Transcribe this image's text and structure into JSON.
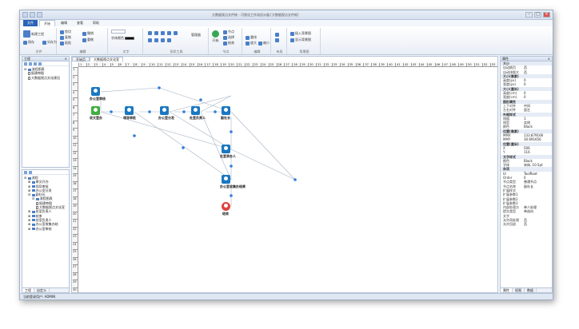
{
  "window": {
    "title": "大数据视点文件帐 - 可视化工作流设计器 [大数据视点文件帐]"
  },
  "tabs": [
    {
      "label": "文件"
    },
    {
      "label": "开始"
    },
    {
      "label": "编辑"
    },
    {
      "label": "查看"
    },
    {
      "label": "帮助"
    }
  ],
  "ribbon": {
    "file_group": {
      "label": "文件",
      "new": "新建工程",
      "open": "打开",
      "save": "保存",
      "save_as": "另存为"
    },
    "edit_group": {
      "label": "编辑",
      "cut": "剪切",
      "copy": "复制",
      "paste": "粘贴",
      "undo": "撤销",
      "redo": "重做"
    },
    "font_group": {
      "label": "文字",
      "font": "宋体",
      "size": "字体颜色"
    },
    "shape_group": {
      "label": "形状工具",
      "sub": "管理器"
    },
    "node_group": {
      "label": "节点",
      "start": "开始",
      "node": "节点",
      "select": "选择",
      "end": "结束"
    },
    "layout_group": {
      "label": "编辑",
      "arrange": "重排",
      "zoom_out": "缩小",
      "zoom_in": "放大"
    },
    "layout2": {
      "label": "布局"
    },
    "bg_group": {
      "label": "背景图",
      "insert": "插入背景图",
      "show": "显示背景图"
    }
  },
  "left_panel": {
    "title": "工程",
    "tree": [
      "流程图表",
      "报建审图",
      "大数据视点文化建设"
    ],
    "bottom_title": "大纲",
    "outline": [
      "流程",
      "审文开办",
      "领导审批",
      "办公室分发",
      "副社长",
      "流程图表",
      "报建审图",
      "大数据视点文化宣",
      "处室负责人",
      "结束",
      "处室负责人",
      "办公室收集办结",
      "办公室审核"
    ],
    "tabs": [
      "工程",
      "自定义"
    ]
  },
  "canvas": {
    "doc_tabs": [
      "开始页",
      "大数据视点文化宣"
    ],
    "ruler_numbers": [
      "1",
      "2",
      "3",
      "4",
      "5",
      "6",
      "7",
      "8",
      "9",
      "10",
      "11",
      "12",
      "13",
      "14",
      "15",
      "16",
      "17",
      "18",
      "19",
      "20",
      "21",
      "22",
      "23",
      "24",
      "25",
      "26",
      "27",
      "28",
      "29",
      "30",
      "31",
      "32",
      "33",
      "34",
      "35",
      "36",
      "37",
      "38",
      "39",
      "40",
      "41",
      "42",
      "43",
      "44",
      "45",
      "46",
      "47",
      "48",
      "49",
      "50",
      "51",
      "52",
      "53"
    ],
    "vruler_numbers": [
      "1",
      "2",
      "3",
      "4",
      "5",
      "6",
      "7",
      "8",
      "9",
      "10",
      "11",
      "12",
      "13",
      "14",
      "15",
      "16",
      "17",
      "18",
      "19",
      "20",
      "21",
      "22",
      "23",
      "24",
      "25",
      "26",
      "27",
      "28",
      "29",
      "30"
    ],
    "nodes": [
      {
        "label": "办公室审核",
        "type": "task"
      },
      {
        "label": "收文登办",
        "type": "start"
      },
      {
        "label": "领导审批",
        "type": "task"
      },
      {
        "label": "办公室分发",
        "type": "task"
      },
      {
        "label": "处室负责人",
        "type": "task"
      },
      {
        "label": "副社长",
        "type": "task"
      },
      {
        "label": "处室承办人",
        "type": "task"
      },
      {
        "label": "办公室收集办结果",
        "type": "task"
      },
      {
        "label": "结束",
        "type": "end"
      }
    ]
  },
  "properties": {
    "title": "属性",
    "rows": [
      {
        "k": "大小",
        "v": "",
        "cat": true
      },
      {
        "k": "自动换页",
        "v": "否"
      },
      {
        "k": "自动排版大",
        "v": "否"
      },
      {
        "k": "大小(像素)",
        "v": "",
        "cat": true
      },
      {
        "k": "高度(px)",
        "v": "0"
      },
      {
        "k": "宽度(px)",
        "v": "0"
      },
      {
        "k": "大小(厘米)",
        "v": "",
        "cat": true
      },
      {
        "k": "高度(cm)",
        "v": "0"
      },
      {
        "k": "宽度(cm)",
        "v": "0"
      },
      {
        "k": "图形属性",
        "v": "",
        "cat": true
      },
      {
        "k": "上下对齐",
        "v": "中间"
      },
      {
        "k": "左右对齐",
        "v": "居左"
      },
      {
        "k": "外框样式",
        "v": "",
        "cat": true
      },
      {
        "k": "线粗",
        "v": "1"
      },
      {
        "k": "线型",
        "v": "实线"
      },
      {
        "k": "颜色",
        "v": "Black"
      },
      {
        "k": "位置(像素)",
        "v": "",
        "cat": true
      },
      {
        "k": "MMX",
        "v": "133.879166"
      },
      {
        "k": "MMY",
        "v": "30.691656"
      },
      {
        "k": "位置(厘米)",
        "v": "",
        "cat": true
      },
      {
        "k": "X",
        "v": "506"
      },
      {
        "k": "Y",
        "v": "116"
      },
      {
        "k": "文字样式",
        "v": "",
        "cat": true
      },
      {
        "k": "颜色",
        "v": "Black"
      },
      {
        "k": "字体",
        "v": "宋体, 10.5pt"
      },
      {
        "k": "杂项",
        "v": "",
        "cat": true
      },
      {
        "k": "Id",
        "v": "ToolRoot"
      },
      {
        "k": "Order",
        "v": "0"
      },
      {
        "k": "节点类型",
        "v": "普通节点"
      },
      {
        "k": "节点名称",
        "v": "副社长"
      },
      {
        "k": "扩展样式",
        "v": ""
      },
      {
        "k": "扩展参数1",
        "v": ""
      },
      {
        "k": "扩展参数2",
        "v": ""
      },
      {
        "k": "扩展参数3",
        "v": ""
      },
      {
        "k": "内部处理方",
        "v": "单人处理"
      },
      {
        "k": "提交类型",
        "v": "单选向"
      },
      {
        "k": "文字",
        "v": ""
      },
      {
        "k": "允许再处理",
        "v": "否"
      },
      {
        "k": "允许回退",
        "v": "否"
      }
    ],
    "tabs": [
      "属性",
      "权限",
      "数据"
    ]
  },
  "status": {
    "text": "当前登录用户: ADMIN"
  }
}
